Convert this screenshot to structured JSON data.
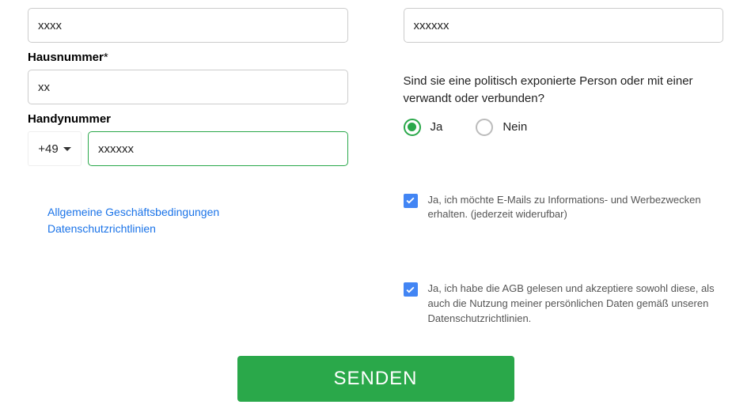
{
  "left": {
    "field1_value": "xxxx",
    "hausnummer_label": "Hausnummer",
    "hausnummer_required": "*",
    "hausnummer_value": "xx",
    "handy_label": "Handynummer",
    "country_code": "+49",
    "phone_value": "xxxxxx",
    "link_agb": "Allgemeine Geschäftsbedingungen",
    "link_privacy": "Datenschutzrichtlinien"
  },
  "right": {
    "field1_value": "xxxxxx",
    "question": "Sind sie eine politisch exponierte Person oder mit einer verwandt oder verbunden?",
    "option_yes": "Ja",
    "option_no": "Nein",
    "checkbox1_text": "Ja, ich möchte E-Mails zu Informations- und Werbezwecken erhalten. (jederzeit widerufbar)",
    "checkbox2_text": "Ja, ich habe die AGB gelesen und akzeptiere sowohl diese, als auch die Nutzung meiner persönlichen Daten gemäß unseren Datenschutzrichtlinien."
  },
  "submit_label": "SENDEN"
}
